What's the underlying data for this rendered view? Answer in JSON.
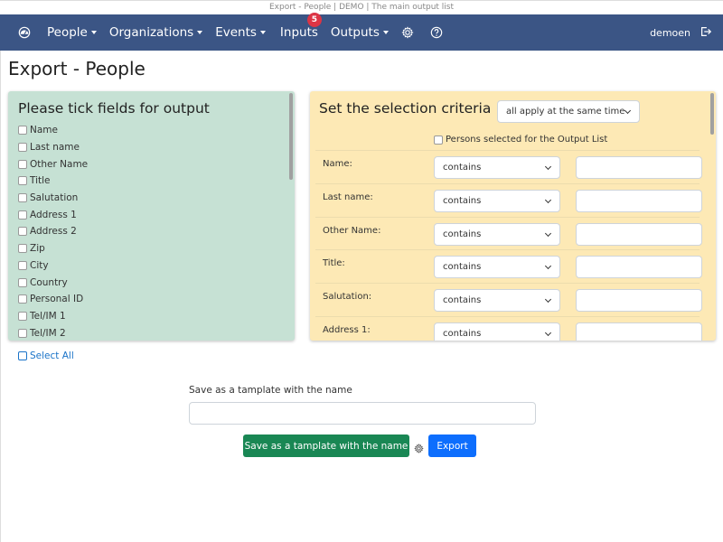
{
  "window": {
    "title": "Export - People | DEMO | The main output list"
  },
  "nav": {
    "items": [
      {
        "label": "People",
        "dropdown": true
      },
      {
        "label": "Organizations",
        "dropdown": true
      },
      {
        "label": "Events",
        "dropdown": true
      },
      {
        "label": "Inputs",
        "dropdown": false,
        "badge": "5"
      },
      {
        "label": "Outputs",
        "dropdown": true
      }
    ],
    "user": "demoen",
    "icons": [
      "dashboard-icon",
      "gear-icon",
      "help-icon",
      "logout-icon"
    ]
  },
  "page": {
    "title": "Export - People"
  },
  "fields_panel": {
    "title": "Please tick fields for output",
    "fields": [
      "Name",
      "Last name",
      "Other Name",
      "Title",
      "Salutation",
      "Address 1",
      "Address 2",
      "Zip",
      "City",
      "Country",
      "Personal ID",
      "Tel/IM 1",
      "Tel/IM 2"
    ],
    "select_all": "Select All"
  },
  "criteria_panel": {
    "title": "Set the selection criteria",
    "apply_mode": "all apply at the same time",
    "persons_selected": "Persons selected for the Output List",
    "rows": [
      {
        "label": "Name:",
        "operator": "contains",
        "value": ""
      },
      {
        "label": "Last name:",
        "operator": "contains",
        "value": ""
      },
      {
        "label": "Other Name:",
        "operator": "contains",
        "value": ""
      },
      {
        "label": "Title:",
        "operator": "contains",
        "value": ""
      },
      {
        "label": "Salutation:",
        "operator": "contains",
        "value": ""
      },
      {
        "label": "Address 1:",
        "operator": "contains",
        "value": ""
      }
    ]
  },
  "template": {
    "label": "Save as a tamplate with the name",
    "value": "",
    "save_button": "Save as a tamplate with the name",
    "export_button": "Export"
  },
  "colors": {
    "navbar": "#3b5585",
    "fields_panel": "#c6e1d4",
    "criteria_panel": "#fde9b5",
    "save_button": "#198754",
    "export_button": "#0d6efd",
    "badge": "#dc3545"
  }
}
